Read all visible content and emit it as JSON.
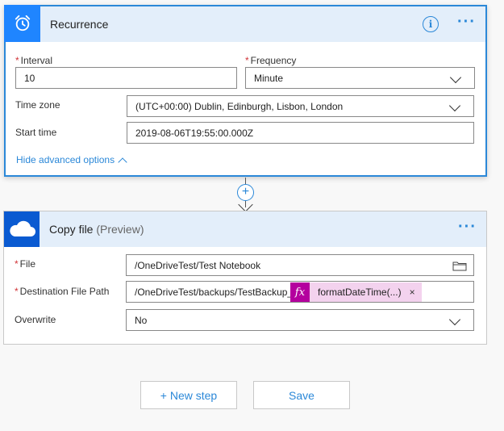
{
  "recurrence": {
    "title": "Recurrence",
    "icon": "alarm-clock-icon",
    "interval_label": "Interval",
    "interval_value": "10",
    "frequency_label": "Frequency",
    "frequency_value": "Minute",
    "timezone_label": "Time zone",
    "timezone_value": "(UTC+00:00) Dublin, Edinburgh, Lisbon, London",
    "start_time_label": "Start time",
    "start_time_value": "2019-08-06T19:55:00.000Z",
    "advanced_link": "Hide advanced options",
    "required_mark": "*",
    "info_glyph": "i",
    "more_glyph": "···"
  },
  "connector": {
    "add_glyph": "+"
  },
  "copy_file": {
    "title": "Copy file",
    "title_suffix": "(Preview)",
    "icon": "onedrive-cloud-icon",
    "file_label": "File",
    "file_value": "/OneDriveTest/Test Notebook",
    "dest_label": "Destination File Path",
    "dest_value": "/OneDriveTest/backups/TestBackup_",
    "dest_token_fx": "fx",
    "dest_token": "formatDateTime(...)",
    "dest_token_close": "×",
    "overwrite_label": "Overwrite",
    "overwrite_value": "No",
    "required_mark": "*",
    "more_glyph": "···"
  },
  "footer": {
    "new_step_label": "+ New step",
    "save_label": "Save"
  },
  "colors": {
    "accent": "#2b88d8",
    "header_bg": "#e3eefa",
    "recurrence_icon_bg": "#1f85ff",
    "onedrive_icon_bg": "#0a5ad1",
    "expression_token": "#b4009e",
    "required": "#d13438"
  }
}
